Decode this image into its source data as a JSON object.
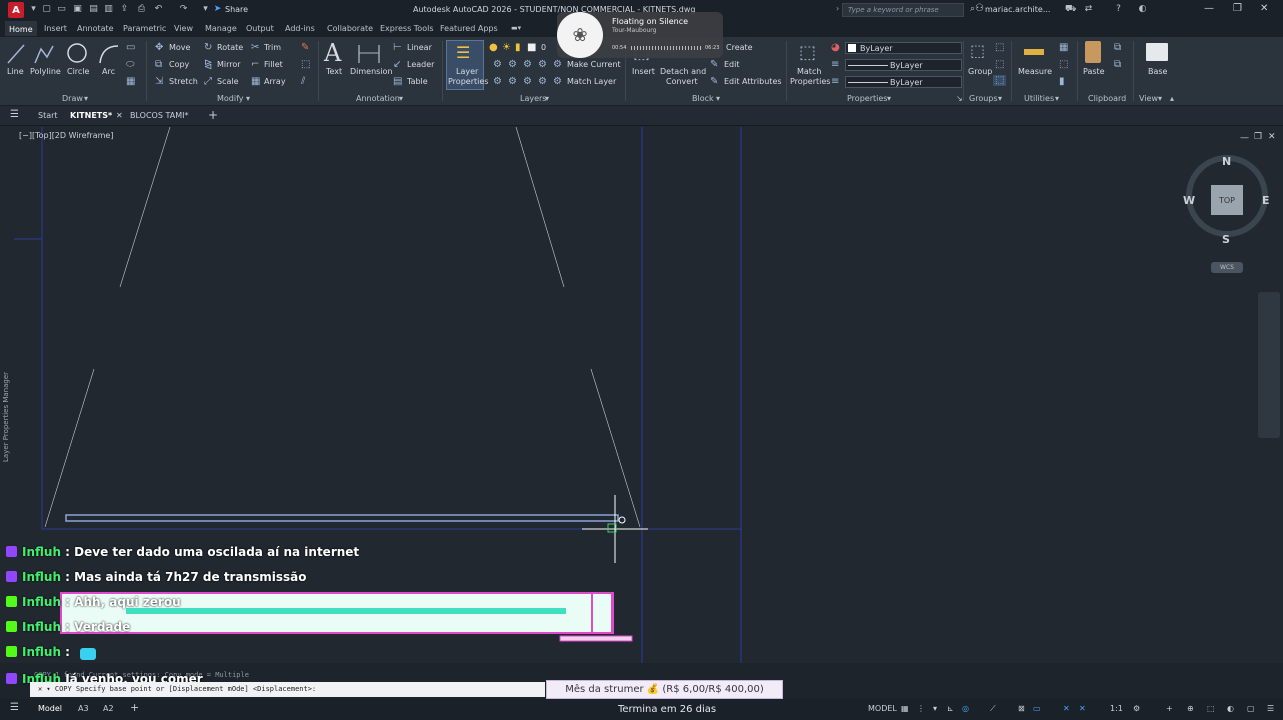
{
  "app": {
    "logo_letter": "A",
    "title": "Autodesk AutoCAD 2026 - STUDENT/NON COMMERCIAL - KITNETS.dwg",
    "share_label": "Share",
    "search_placeholder": "Type a keyword or phrase",
    "user": "mariac.archite..."
  },
  "ribbon_tabs": [
    "Home",
    "Insert",
    "Annotate",
    "Parametric",
    "View",
    "Manage",
    "Output",
    "Add-ins",
    "Collaborate",
    "Express Tools",
    "Featured Apps"
  ],
  "ribbon": {
    "draw": {
      "title": "Draw",
      "line": "Line",
      "polyline": "Polyline",
      "circle": "Circle",
      "arc": "Arc"
    },
    "modify": {
      "title": "Modify",
      "move": "Move",
      "rotate": "Rotate",
      "trim": "Trim",
      "copy": "Copy",
      "mirror": "Mirror",
      "fillet": "Fillet",
      "stretch": "Stretch",
      "scale": "Scale",
      "array": "Array"
    },
    "annotation": {
      "title": "Annotation",
      "text": "Text",
      "dimension": "Dimension",
      "linear": "Linear",
      "leader": "Leader",
      "table": "Table"
    },
    "layers": {
      "title": "Layers",
      "layer_properties_1": "Layer",
      "layer_properties_2": "Properties",
      "current_layer": "0",
      "make_current": "Make Current",
      "match_layer": "Match Layer"
    },
    "block": {
      "title": "Block",
      "insert": "Insert",
      "create": "Create",
      "edit": "Edit",
      "edit_attributes": "Edit Attributes",
      "detach_1": "Detach and",
      "detach_2": "Convert"
    },
    "properties": {
      "title": "Properties",
      "match_1": "Match",
      "match_2": "Properties",
      "color": "ByLayer",
      "linetype": "ByLayer",
      "lineweight": "ByLayer"
    },
    "groups": {
      "title": "Groups",
      "group": "Group"
    },
    "utilities": {
      "title": "Utilities",
      "measure": "Measure"
    },
    "clipboard": {
      "title": "Clipboard",
      "paste": "Paste"
    },
    "view": {
      "title": "View",
      "base": "Base"
    }
  },
  "doc_tabs": {
    "start": "Start",
    "active": "KITNETS*",
    "other": "BLOCOS TAMI*"
  },
  "viewport": {
    "label": "[−][Top][2D Wireframe]",
    "side_panel": "Layer Properties Manager",
    "compass": {
      "n": "N",
      "s": "S",
      "e": "E",
      "w": "W",
      "face": "TOP",
      "wcs": "WCS"
    }
  },
  "music_popup": {
    "title": "Floating on Silence",
    "artist": "Tour-Maubourg",
    "time_elapsed": "00:54",
    "time_total": "06:23"
  },
  "chat": [
    {
      "platform": "twitch",
      "user": "Influh",
      "message": "Deve ter dado uma oscilada aí na internet"
    },
    {
      "platform": "twitch",
      "user": "Influh",
      "message": "Mas ainda tá 7h27 de transmissão"
    },
    {
      "platform": "kick",
      "user": "Influh",
      "message": "Ahh, aqui zerou"
    },
    {
      "platform": "kick",
      "user": "Influh",
      "message": "Verdade"
    },
    {
      "platform": "kick",
      "user": "Influh",
      "message": ""
    },
    {
      "platform": "twitch",
      "user": "Influh",
      "message": "Já venho, vou comer"
    }
  ],
  "command": {
    "history": "COPY 1 found    Current settings: Copy mode = Multiple",
    "prompt": "✕ ▾ COPY Specify base point or [Displacement mOde] <Displacement>:"
  },
  "overlay": {
    "subscription": "Mês da strumer 💰 (R$ 6,00/R$ 400,00)",
    "ends": "Termina em 26 dias"
  },
  "status": {
    "model": "Model",
    "layout1": "A3",
    "layout2": "A2",
    "model_space": "MODEL",
    "scale": "1:1"
  },
  "colors": {
    "accent": "#3d8be0",
    "chat_name": "#3ff06d",
    "twitch": "#9146ff",
    "kick": "#53fc18",
    "geometry": "#2b3a9a"
  }
}
